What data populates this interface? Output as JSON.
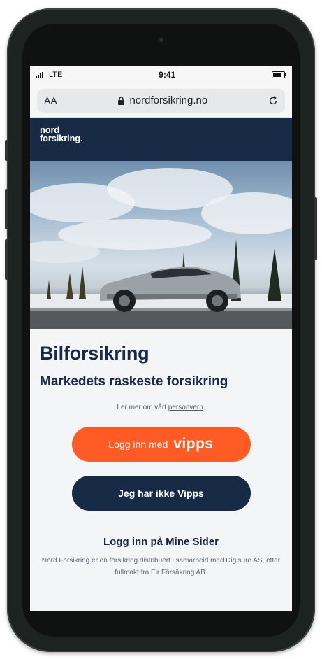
{
  "status_bar": {
    "network": "LTE",
    "time": "9:41"
  },
  "browser": {
    "text_size_label": "AA",
    "url": "nordforsikring.no"
  },
  "site": {
    "logo_line1": "nord",
    "logo_line2": "forsikring."
  },
  "main": {
    "title": "Bilforsikring",
    "subtitle": "Markedets raskeste forsikring",
    "privacy_prefix": "Ler mer om vårt",
    "privacy_link": "personvern",
    "privacy_suffix": ".",
    "vipps_button_prefix": "Logg inn med",
    "vipps_button_brand": "vipps",
    "no_vipps_button": "Jeg har ikke Vipps",
    "mine_sider_link": "Logg inn på Mine Sider",
    "footer_note": "Nord Forsikring er en forsikring distribuert i samarbeid med Digisure AS, etter fullmakt fra Eir Försäkring AB."
  },
  "colors": {
    "navy": "#172a46",
    "vipps_orange": "#ff5b24",
    "page_bg": "#f4f5f7"
  },
  "icons": [
    "signal-icon",
    "battery-icon",
    "lock-icon",
    "reload-icon",
    "vipps-logo"
  ]
}
